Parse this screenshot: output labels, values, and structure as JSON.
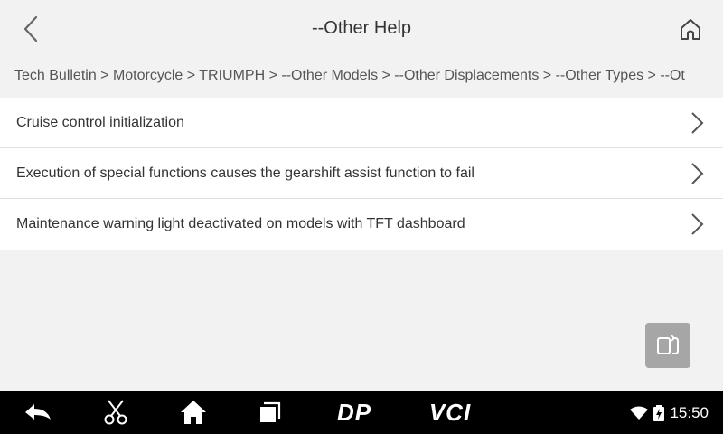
{
  "header": {
    "title": "--Other Help",
    "back_icon": "chevron-left-icon",
    "home_icon": "home-icon"
  },
  "breadcrumb": "Tech Bulletin > Motorcycle > TRIUMPH > --Other Models > --Other Displacements > --Other Types > --Ot",
  "items": [
    {
      "label": "Cruise control initialization"
    },
    {
      "label": "Execution of special functions causes the gearshift assist function to fail"
    },
    {
      "label": "Maintenance warning light deactivated on models with TFT dashboard"
    }
  ],
  "float_button_icon": "screen-switch-icon",
  "navbar": {
    "dp_label": "DP",
    "vci_label": "VCI",
    "time": "15:50",
    "icons": [
      "back-arrow-icon",
      "scissors-icon",
      "home-icon",
      "recent-apps-icon",
      "wifi-icon",
      "battery-charging-icon"
    ]
  },
  "colors": {
    "background": "#f2f2f2",
    "list_bg": "#ffffff",
    "navbar": "#000000",
    "float_button": "#a6a6a6"
  }
}
